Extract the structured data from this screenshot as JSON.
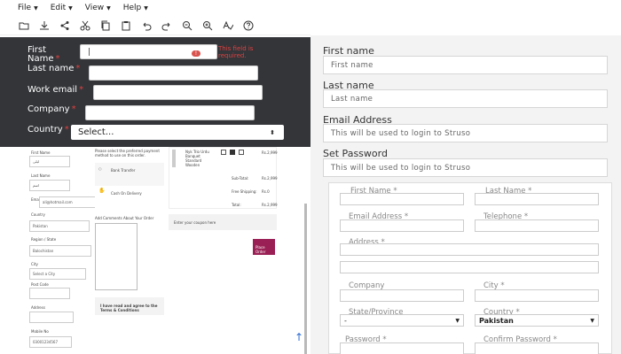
{
  "menubar": {
    "items": [
      "File",
      "Edit",
      "View",
      "Help"
    ]
  },
  "toolbar": {
    "icons": [
      "folder-icon",
      "download-icon",
      "share-icon",
      "cut-icon",
      "copy-icon",
      "paste-icon",
      "undo-icon",
      "redo-icon",
      "zoom-out-icon",
      "zoom-in-icon",
      "spellcheck-icon",
      "help-icon"
    ]
  },
  "dark_form": {
    "first_name_label": "First Name",
    "first_name_value": "|",
    "error_text": "This field is required.",
    "error_badge": "!",
    "last_name_label": "Last name",
    "work_email_label": "Work email",
    "company_label": "Company",
    "country_label": "Country",
    "country_select": "Select...",
    "required_mark": "*"
  },
  "checkout": {
    "first_name_label": "First Name",
    "first_name_value": "ليلى",
    "last_name_label": "Last Name",
    "last_name_value": "اسم",
    "email_label": "Email",
    "email_value": "ali@hotmail.com",
    "country_label": "Country",
    "country_value": "Pakistan",
    "region_label": "Region / State",
    "region_value": "Balochistan",
    "city_label": "City",
    "city_value": "Select a City",
    "postcode_label": "Post Code",
    "address_label": "Address",
    "mobile_label": "Mobile No",
    "mobile_value": "03001234567",
    "payment_text": "Please select the preferred payment method to use on this order.",
    "bank_transfer": "Bank Transfer",
    "cash_on_delivery": "Cash On Delivery",
    "comments_label": "Add Comments About Your Order",
    "terms_text": "I have read and agree to the Terms & Conditions",
    "product_text": "Nyk Trio Urdu Banquet Standard Wooden",
    "product_price": "Rs.2,999",
    "subtotal_label": "Sub-Total:",
    "subtotal_value": "Rs.2,999",
    "shipping_label": "Free Shipping:",
    "shipping_value": "Rs.0",
    "total_label": "Total:",
    "total_value": "Rs.2,999",
    "coupon_text": "Enter your coupon here",
    "place_order": "Place Order"
  },
  "right_form": {
    "first_name_label": "First name",
    "first_name_placeholder": "First name",
    "last_name_label": "Last name",
    "last_name_placeholder": "Last name",
    "email_label": "Email Address",
    "email_placeholder": "This will be used to login to Struso",
    "password_label": "Set Password",
    "password_placeholder": "This will be used to login to Struso"
  },
  "right_panel": {
    "first_name": "First Name *",
    "last_name": "Last Name *",
    "email": "Email Address *",
    "telephone": "Telephone *",
    "address": "Address *",
    "company": "Company",
    "city": "City *",
    "state": "State/Province",
    "country": "Country *",
    "country_value": "Pakistan",
    "state_value": "-",
    "password": "Password *",
    "confirm_password": "Confirm Password *"
  }
}
